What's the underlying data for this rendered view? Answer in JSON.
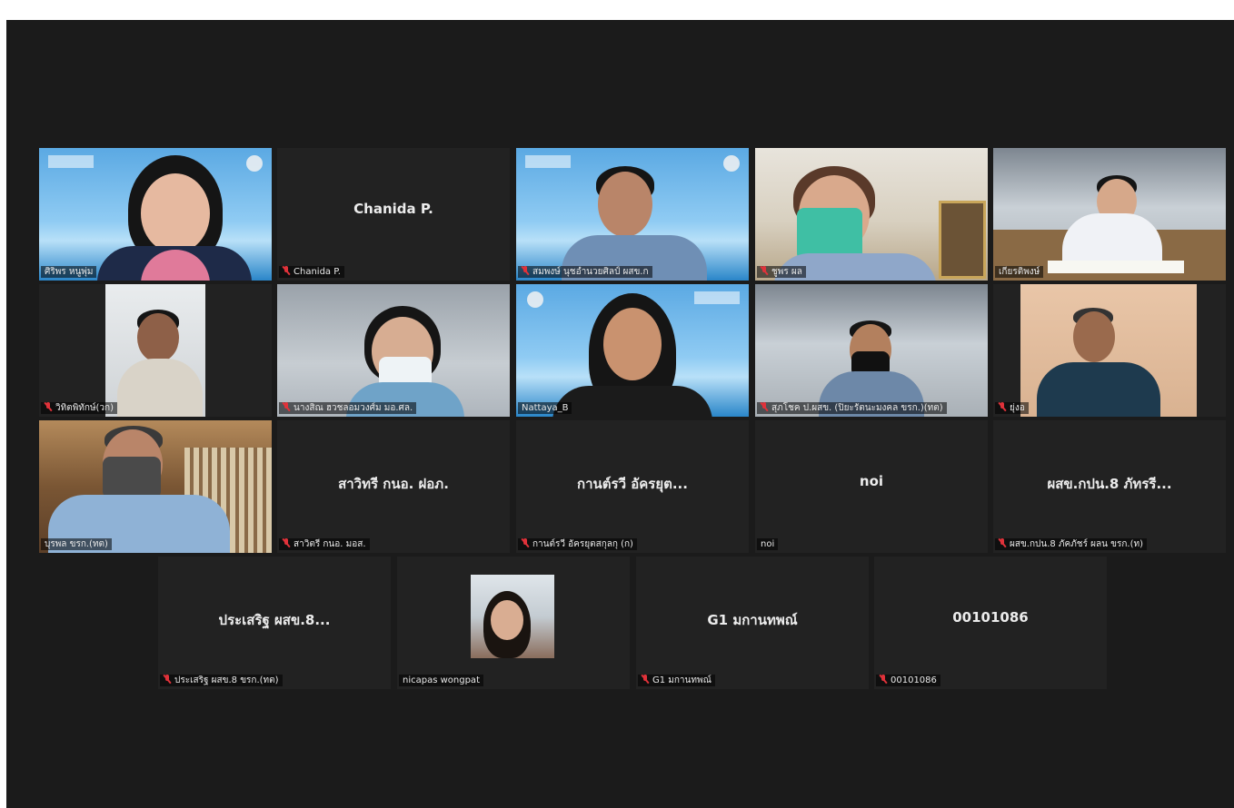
{
  "app": "Zoom meeting gallery view",
  "colors": {
    "active_speaker_border": "#c8d83a",
    "muted_icon": "#e0323a",
    "tile_bg": "#222222",
    "stage_bg": "#1b1b1b"
  },
  "participants": [
    {
      "caption": "ศิริพร หนูพุ่ม",
      "center_name": "",
      "muted": false,
      "video": true
    },
    {
      "caption": "Chanida P.",
      "center_name": "Chanida P.",
      "muted": true,
      "video": false
    },
    {
      "caption": "สมพงษ์ นุชอำนวยศิลป์ ผสข.ก",
      "center_name": "",
      "muted": true,
      "video": true
    },
    {
      "caption": "ชูพร ผล",
      "center_name": "",
      "muted": true,
      "video": true
    },
    {
      "caption": "เกียรติพงษ์",
      "center_name": "",
      "muted": false,
      "video": true
    },
    {
      "caption": "วิทิตพิทักษ์(วก)",
      "center_name": "",
      "muted": true,
      "video": true
    },
    {
      "caption": "นางสิณ ฮวชลอมวงศ์ม มอ.ศล.",
      "center_name": "",
      "muted": true,
      "video": true
    },
    {
      "caption": "Nattaya_B",
      "center_name": "",
      "muted": false,
      "video": true,
      "active": true
    },
    {
      "caption": "สุภโชค ป.ผสข. (ปิยะรัตนะมงคล ขรก.)(ทต)",
      "center_name": "",
      "muted": true,
      "video": true
    },
    {
      "caption": "ยุ่งอ",
      "center_name": "",
      "muted": true,
      "video": true
    },
    {
      "caption": "บุรพล ขรก.(ทต)",
      "center_name": "",
      "muted": false,
      "video": true
    },
    {
      "caption": "สาวิตรี กนอ. มอส.",
      "center_name": "สาวิทรี กนอ. ฝอภ.",
      "muted": true,
      "video": false
    },
    {
      "caption": "กานต์รวี อัครยุตสกุลกุ (ก)",
      "center_name": "กานต์รวี อัครยุต...",
      "muted": true,
      "video": false
    },
    {
      "caption": "noi",
      "center_name": "noi",
      "muted": false,
      "video": false
    },
    {
      "caption": "ผสข.กปน.8 ภัคภัชร์ ผลน ขรก.(ท)",
      "center_name": "ผสข.กปน.8 ภัทรรี...",
      "muted": true,
      "video": false
    },
    {
      "caption": "ประเสริฐ ผสข.8 ขรก.(ทต)",
      "center_name": "ประเสริฐ ผสข.8...",
      "muted": true,
      "video": false
    },
    {
      "caption": "nicapas wongpat",
      "center_name": "",
      "muted": false,
      "video": false,
      "avatar": true
    },
    {
      "caption": "G1 มกานทพณ์",
      "center_name": "G1 มกานทพณ์",
      "muted": true,
      "video": false
    },
    {
      "caption": "00101086",
      "center_name": "00101086",
      "muted": true,
      "video": false
    }
  ]
}
